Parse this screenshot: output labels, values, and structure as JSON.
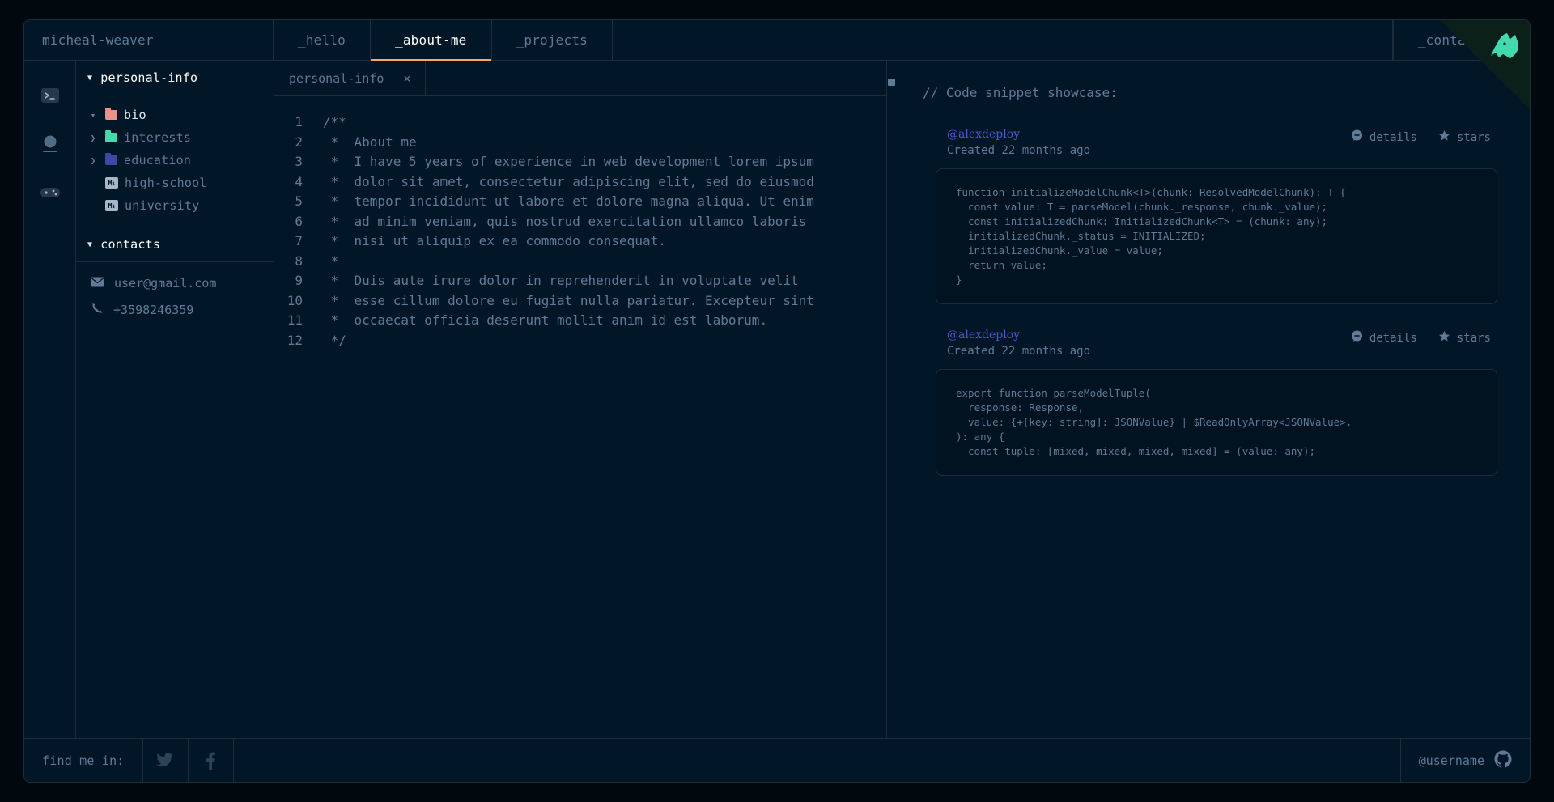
{
  "window": {
    "brand": "micheal-weaver",
    "accent_active": "#fea55f",
    "bg": "#011627",
    "border": "#1e2d3d",
    "text_muted": "#607b96",
    "text_bright": "#fffffe",
    "link_blue": "#4d5bce",
    "corner_icon": "github-cat-icon"
  },
  "top_tabs": [
    {
      "label": "_hello",
      "active": false
    },
    {
      "label": "_about-me",
      "active": true
    },
    {
      "label": "_projects",
      "active": false
    }
  ],
  "top_tab_right": {
    "label": "_contact-me"
  },
  "rail": [
    {
      "icon": "terminal-icon",
      "name": "rail-terminal"
    },
    {
      "icon": "profile-icon",
      "name": "rail-profile"
    },
    {
      "icon": "gamepad-icon",
      "name": "rail-gamepad"
    }
  ],
  "tree": {
    "sections": [
      {
        "title": "personal-info",
        "expanded": true,
        "items": [
          {
            "label": "bio",
            "type": "folder",
            "color": "#e99287",
            "expanded": true,
            "active": true,
            "depth": 0
          },
          {
            "label": "interests",
            "type": "folder",
            "color": "#43d9ad",
            "expanded": false,
            "active": false,
            "depth": 0
          },
          {
            "label": "education",
            "type": "folder",
            "color": "#3a49a4",
            "expanded": false,
            "active": false,
            "depth": 0
          },
          {
            "label": "high-school",
            "type": "markdown",
            "badge": "M↓",
            "depth": 1
          },
          {
            "label": "university",
            "type": "markdown",
            "badge": "M↓",
            "depth": 1
          }
        ]
      }
    ],
    "contacts": {
      "title": "contacts",
      "expanded": true,
      "items": [
        {
          "label": "user@gmail.com",
          "icon": "mail-icon"
        },
        {
          "label": "+3598246359",
          "icon": "phone-icon"
        }
      ]
    }
  },
  "editor": {
    "tab": {
      "label": "personal-info",
      "close": "×"
    },
    "lines": [
      {
        "n": "1",
        "text": "/**"
      },
      {
        "n": "2",
        "text": " *  About me"
      },
      {
        "n": "3",
        "text": " *  I have 5 years of experience in web development lorem ipsum"
      },
      {
        "n": "4",
        "text": " *  dolor sit amet, consectetur adipiscing elit, sed do eiusmod"
      },
      {
        "n": "5",
        "text": " *  tempor incididunt ut labore et dolore magna aliqua. Ut enim"
      },
      {
        "n": "6",
        "text": " *  ad minim veniam, quis nostrud exercitation ullamco laboris"
      },
      {
        "n": "7",
        "text": " *  nisi ut aliquip ex ea commodo consequat."
      },
      {
        "n": "8",
        "text": " *"
      },
      {
        "n": "9",
        "text": " *  Duis aute irure dolor in reprehenderit in voluptate velit"
      },
      {
        "n": "10",
        "text": " *  esse cillum dolore eu fugiat nulla pariatur. Excepteur sint"
      },
      {
        "n": "11",
        "text": " *  occaecat officia deserunt mollit anim id est laborum."
      },
      {
        "n": "12",
        "text": " */"
      }
    ]
  },
  "snippets": {
    "title": "// Code snippet showcase:",
    "action_details": "details",
    "action_stars": "stars",
    "items": [
      {
        "user": "@alexdeploy",
        "created": "Created 22 months ago",
        "code": "function initializeModelChunk<T>(chunk: ResolvedModelChunk): T {\n  const value: T = parseModel(chunk._response, chunk._value);\n  const initializedChunk: InitializedChunk<T> = (chunk: any);\n  initializedChunk._status = INITIALIZED;\n  initializedChunk._value = value;\n  return value;\n}"
      },
      {
        "user": "@alexdeploy",
        "created": "Created 22 months ago",
        "code": "export function parseModelTuple(\n  response: Response,\n  value: {+[key: string]: JSONValue} | $ReadOnlyArray<JSONValue>,\n): any {\n  const tuple: [mixed, mixed, mixed, mixed] = (value: any);"
      }
    ]
  },
  "footer": {
    "label": "find me in:",
    "socials": [
      {
        "name": "twitter-icon"
      },
      {
        "name": "facebook-icon"
      }
    ],
    "github_handle": "@username",
    "github_icon": "github-icon"
  }
}
